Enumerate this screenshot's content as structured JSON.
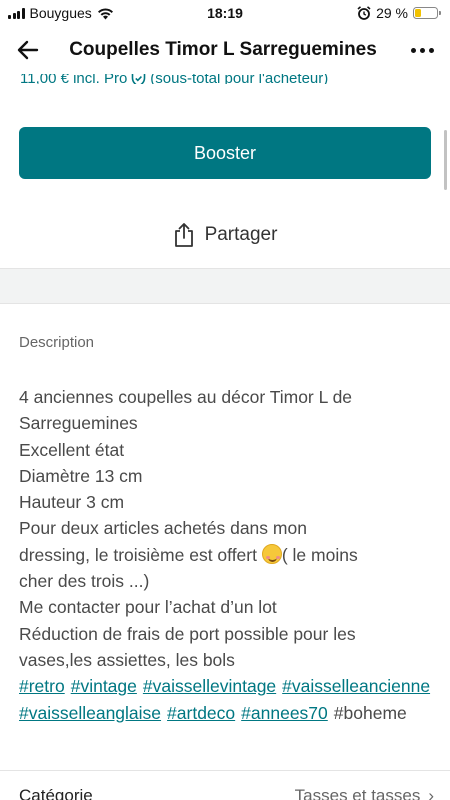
{
  "status_bar": {
    "carrier": "Bouygues",
    "time": "18:19",
    "battery_text": "29 %",
    "battery_level": 0.29,
    "battery_color": "#f2c200"
  },
  "header": {
    "title": "Coupelles Timor L Sarreguemines",
    "back_icon": "arrow-left-icon",
    "more_icon": "more-horizontal-icon"
  },
  "price_line": {
    "amount": "11,00 € incl. Pro",
    "note": "(sous-total pour l'acheteur)"
  },
  "actions": {
    "boost_label": "Booster",
    "share_label": "Partager"
  },
  "description": {
    "label": "Description",
    "lines": [
      "4 anciennes coupelles au décor Timor L de",
      "Sarreguemines",
      "Excellent état",
      "Diamètre 13 cm",
      "Hauteur 3 cm",
      "Pour deux articles achetés dans mon",
      "dressing, le troisième est offert",
      "( le moins",
      "cher des trois ...)",
      "Me contacter pour l’achat d’un lot",
      "Réduction de frais de port possible pour les",
      "vases,les assiettes, les bols"
    ],
    "tags": [
      "#retro",
      "#vintage",
      "#vaissellevintage",
      "#vaisselleancienne",
      "#vaisselleanglaise",
      "#artdeco",
      "#annees70"
    ],
    "plain_tag": "#boheme"
  },
  "details": {
    "category_label": "Catégorie",
    "category_value": "Tasses et tasses"
  },
  "colors": {
    "accent": "#007782",
    "text": "#4a4a4a",
    "band": "#f2f3f3"
  }
}
